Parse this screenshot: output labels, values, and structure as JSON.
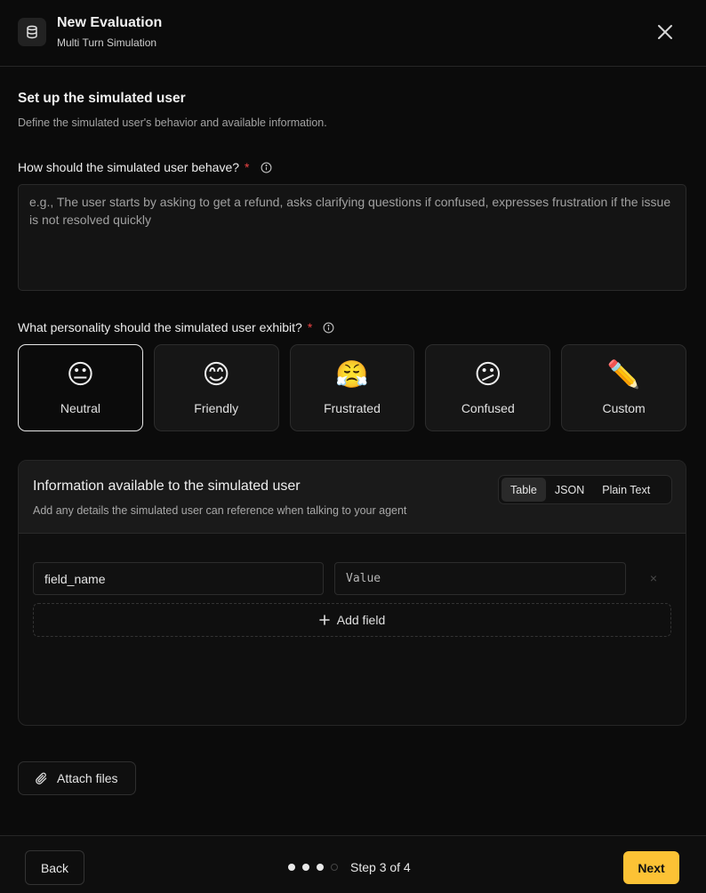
{
  "header": {
    "title": "New Evaluation",
    "subtitle": "Multi Turn Simulation",
    "icon": "database-icon",
    "close_icon": "close-icon"
  },
  "section": {
    "title": "Set up the simulated user",
    "description": "Define the simulated user's behavior and available information."
  },
  "behavior": {
    "label": "How should the simulated user behave?",
    "required_mark": "*",
    "value": "",
    "placeholder": "e.g., The user starts by asking to get a refund, asks clarifying questions if confused, expresses frustration if the issue is not resolved quickly"
  },
  "personality": {
    "label": "What personality should the simulated user exhibit?",
    "required_mark": "*",
    "selected": "Neutral",
    "options": [
      {
        "emoji": "😐",
        "label": "Neutral"
      },
      {
        "emoji": "😊",
        "label": "Friendly"
      },
      {
        "emoji": "😤",
        "label": "Frustrated"
      },
      {
        "emoji": "😕",
        "label": "Confused"
      },
      {
        "emoji": "✏️",
        "label": "Custom"
      }
    ]
  },
  "info_panel": {
    "title": "Information available to the simulated user",
    "description": "Add any details the simulated user can reference when talking to your agent",
    "tabs": [
      "Table",
      "JSON",
      "Plain Text"
    ],
    "active_tab": "Table",
    "rows": [
      {
        "name": "field_name",
        "value": "",
        "value_placeholder": "Value",
        "remove": "×"
      }
    ],
    "add_field_label": "Add field"
  },
  "attach": {
    "label": "Attach files",
    "icon": "paperclip-icon"
  },
  "footer": {
    "back_label": "Back",
    "step_text": "Step 3 of 4",
    "current_step": 3,
    "total_steps": 4,
    "next_label": "Next",
    "accent_color": "#fcc235"
  }
}
